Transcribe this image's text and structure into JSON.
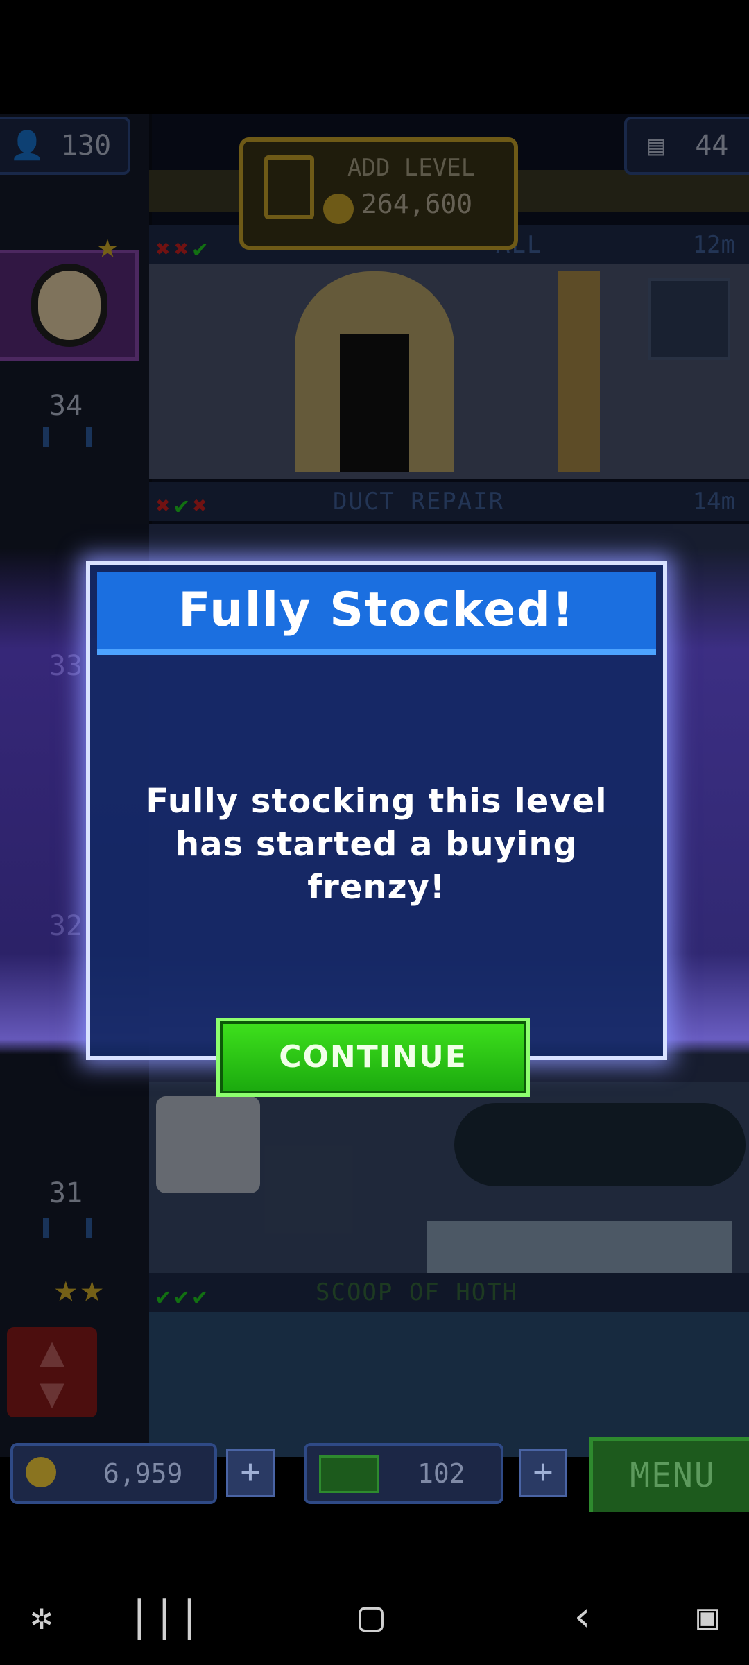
{
  "hud": {
    "population": "130",
    "floors": "44",
    "add_level_label": "ADD LEVEL",
    "add_level_cost": "264,600",
    "coins": "6,959",
    "bux": "102",
    "plus": "+",
    "menu": "MENU"
  },
  "elevator": {
    "floor_34": "34",
    "floor_33": "33",
    "floor_32": "32",
    "floor_31": "31"
  },
  "floors": [
    {
      "name": "ALL",
      "time": "12m",
      "checks": [
        "x",
        "x",
        "ok"
      ]
    },
    {
      "name": "DUCT REPAIR",
      "time": "14m",
      "checks": [
        "x",
        "ok",
        "x"
      ]
    },
    {
      "name": "SCOOP OF HOTH",
      "time": "",
      "checks": [
        "ok",
        "ok",
        "ok"
      ]
    }
  ],
  "dialog": {
    "title": "Fully Stocked!",
    "message": "Fully stocking this level has started a buying frenzy!",
    "continue": "CONTINUE"
  },
  "icons": {
    "population": "person-icon",
    "floors": "building-icon",
    "coin": "coin-icon",
    "bux": "bux-icon"
  },
  "colors": {
    "dialog_title_bg": "#1b6fe0",
    "continue_bg": "#2ac515",
    "dialog_bg": "#142864"
  }
}
